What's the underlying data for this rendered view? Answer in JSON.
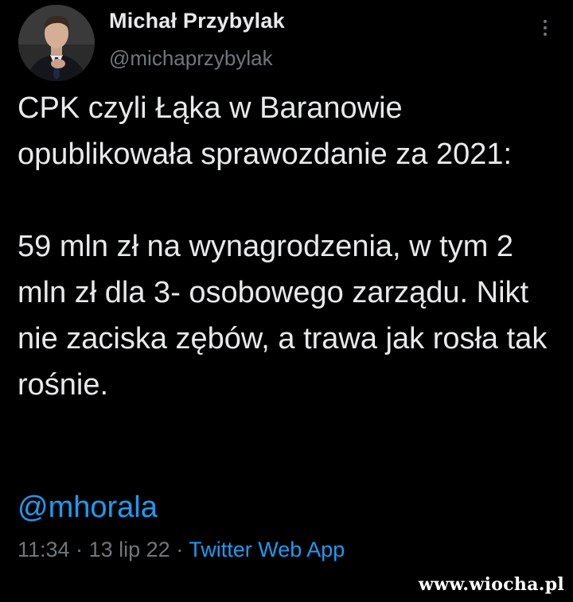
{
  "author": {
    "name": "Michał Przybylak",
    "handle": "@michaprzybylak"
  },
  "tweet": {
    "paragraph_1": "CPK czyli Łąka w Baranowie opublikowała sprawozdanie za 2021:",
    "paragraph_2": "59 mln zł na wynagrodzenia, w tym 2 mln zł dla 3- osobowego zarządu. Nikt nie zaciska zębów, a trawa jak rosła tak rośnie.",
    "mention": "@mhorala"
  },
  "meta": {
    "time": "11:34",
    "separator": "·",
    "date": "13 lip 22",
    "source": "Twitter Web App"
  },
  "watermark": {
    "text": "www.wiocha.pl"
  },
  "icons": {
    "more": "more-vertical-icon",
    "avatar": "avatar-photo"
  },
  "colors": {
    "background": "#000000",
    "text": "#e7e9ea",
    "muted": "#71767b",
    "link": "#1d9bf0"
  }
}
